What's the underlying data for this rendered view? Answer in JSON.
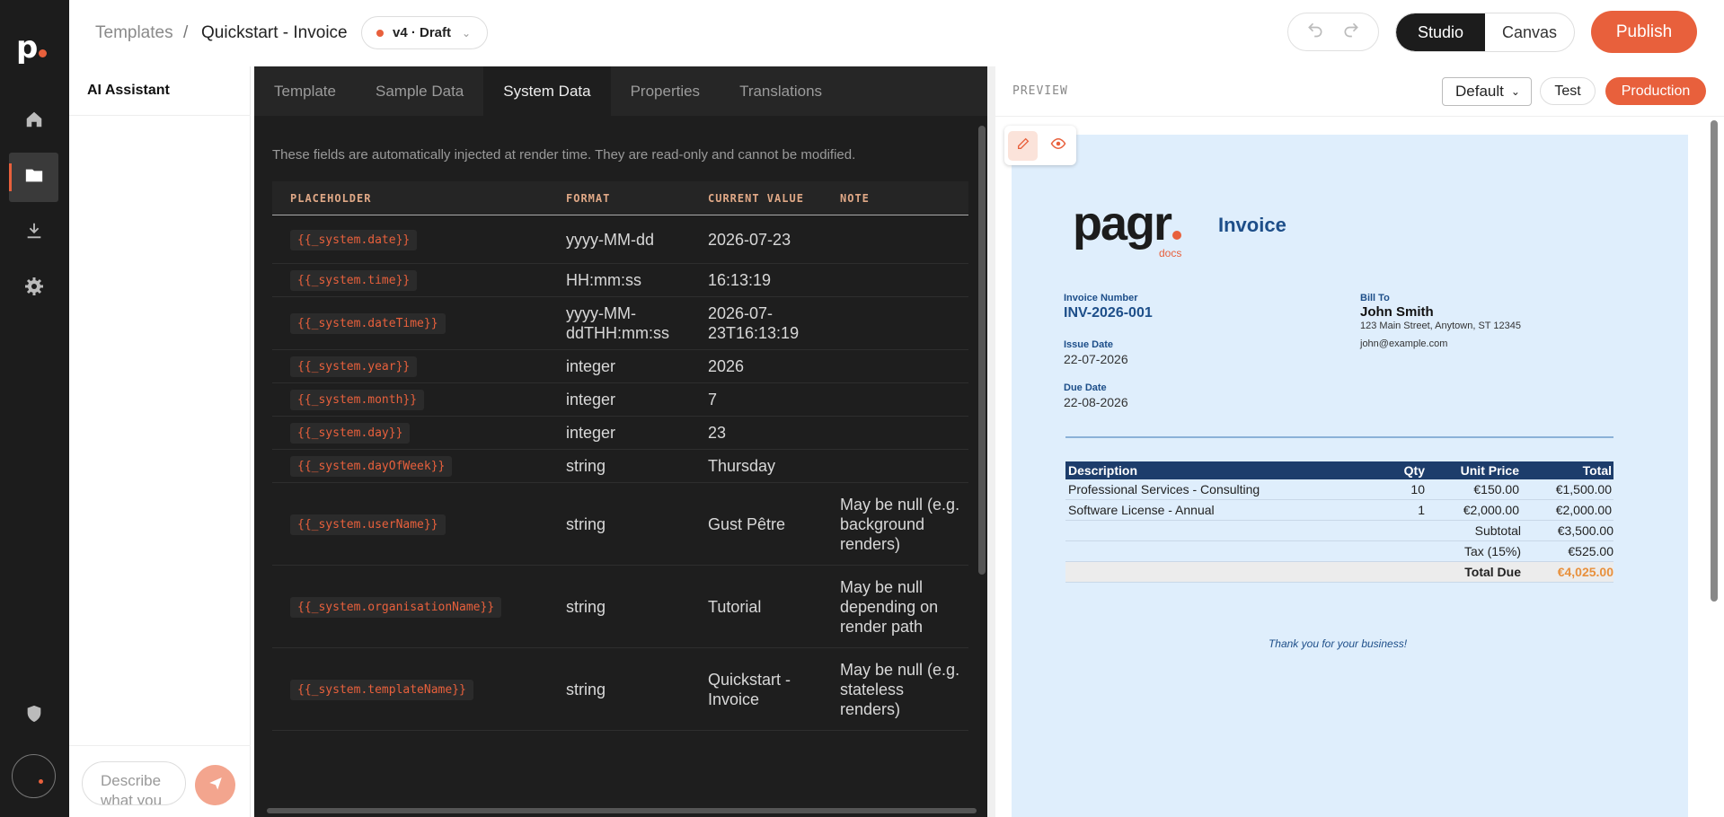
{
  "breadcrumb": {
    "parent": "Templates",
    "separator": "/",
    "current": "Quickstart - Invoice"
  },
  "version": {
    "label": "v4 · Draft"
  },
  "mode_toggle": {
    "studio": "Studio",
    "canvas": "Canvas"
  },
  "publish_label": "Publish",
  "ai": {
    "title": "AI Assistant",
    "input_placeholder": "Describe what you"
  },
  "editor": {
    "tabs": [
      "Template",
      "Sample Data",
      "System Data",
      "Properties",
      "Translations"
    ],
    "active_tab": "System Data",
    "help_text": "These fields are automatically injected at render time. They are read-only and cannot be modified.",
    "columns": [
      "PLACEHOLDER",
      "FORMAT",
      "CURRENT VALUE",
      "NOTE"
    ],
    "rows": [
      {
        "placeholder": "{{_system.date}}",
        "format": "yyyy-MM-dd",
        "value": "2026-07-23",
        "note": ""
      },
      {
        "placeholder": "{{_system.time}}",
        "format": "HH:mm:ss",
        "value": "16:13:19",
        "note": ""
      },
      {
        "placeholder": "{{_system.dateTime}}",
        "format": "yyyy-MM-ddTHH:mm:ss",
        "value": "2026-07-23T16:13:19",
        "note": ""
      },
      {
        "placeholder": "{{_system.year}}",
        "format": "integer",
        "value": "2026",
        "note": ""
      },
      {
        "placeholder": "{{_system.month}}",
        "format": "integer",
        "value": "7",
        "note": ""
      },
      {
        "placeholder": "{{_system.day}}",
        "format": "integer",
        "value": "23",
        "note": ""
      },
      {
        "placeholder": "{{_system.dayOfWeek}}",
        "format": "string",
        "value": "Thursday",
        "note": ""
      },
      {
        "placeholder": "{{_system.userName}}",
        "format": "string",
        "value": "Gust Pêtre",
        "note": "May be null (e.g. background renders)"
      },
      {
        "placeholder": "{{_system.organisationName}}",
        "format": "string",
        "value": "Tutorial",
        "note": "May be null depending on render path"
      },
      {
        "placeholder": "{{_system.templateName}}",
        "format": "string",
        "value": "Quickstart - Invoice",
        "note": "May be null (e.g. stateless renders)"
      }
    ]
  },
  "preview": {
    "label": "PREVIEW",
    "select_value": "Default",
    "test_label": "Test",
    "production_label": "Production"
  },
  "invoice": {
    "brand": "pagr",
    "brand_sub": "docs",
    "title": "Invoice",
    "number_label": "Invoice Number",
    "number": "INV-2026-001",
    "issue_label": "Issue Date",
    "issue_date": "22-07-2026",
    "due_label": "Due Date",
    "due_date": "22-08-2026",
    "bill_to_label": "Bill To",
    "customer_name": "John Smith",
    "customer_address": "123 Main Street, Anytown, ST 12345",
    "customer_email": "john@example.com",
    "columns": [
      "Description",
      "Qty",
      "Unit Price",
      "Total"
    ],
    "items": [
      {
        "description": "Professional Services - Consulting",
        "qty": "10",
        "unit": "€150.00",
        "total": "€1,500.00"
      },
      {
        "description": "Software License - Annual",
        "qty": "1",
        "unit": "€2,000.00",
        "total": "€2,000.00"
      }
    ],
    "subtotal_label": "Subtotal",
    "subtotal": "€3,500.00",
    "tax_label": "Tax (15%)",
    "tax": "€525.00",
    "total_label": "Total Due",
    "total": "€4,025.00",
    "thanks": "Thank you for your business!"
  },
  "colors": {
    "accent": "#e8603c",
    "rail": "#1c1c1c",
    "editor_bg": "#1e1e1e",
    "invoice_blue": "#1d4e89",
    "canvas_bg": "#dfeefc"
  },
  "icons": [
    "home-icon",
    "folder-icon",
    "download-icon",
    "gear-icon",
    "shield-icon",
    "undo-icon",
    "redo-icon",
    "send-icon",
    "edit-icon",
    "eye-icon"
  ]
}
